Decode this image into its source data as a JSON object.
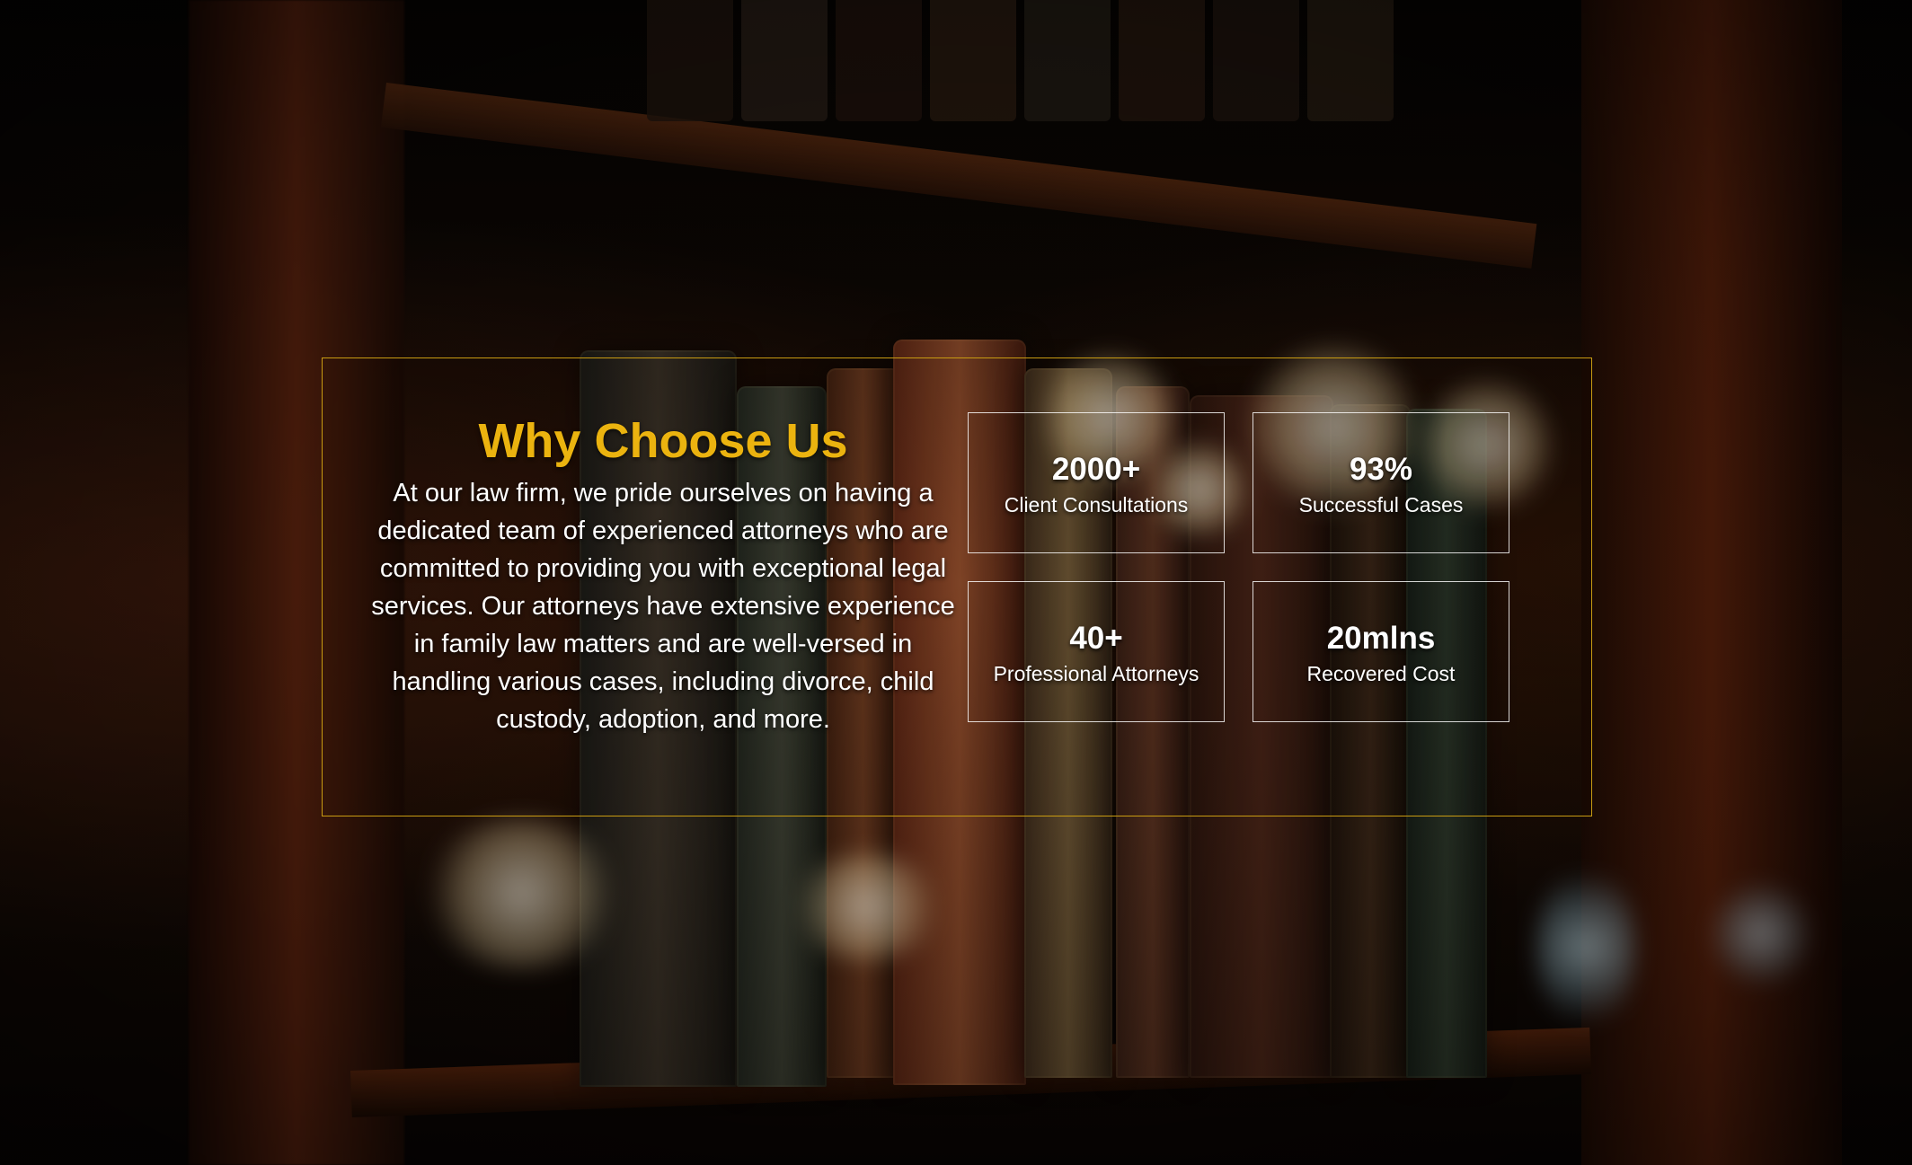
{
  "section": {
    "title": "Why Choose Us",
    "description": "At our law firm, we pride ourselves on having a dedicated team of experienced attorneys who are committed to providing you with exceptional legal services. Our attorneys have extensive experience in family law matters and are well-versed in handling various cases, including divorce, child custody, adoption, and more."
  },
  "stats": [
    {
      "value": "2000+",
      "label": "Client Consultations"
    },
    {
      "value": "93%",
      "label": "Successful Cases"
    },
    {
      "value": "40+",
      "label": "Professional Attorneys"
    },
    {
      "value": "20mlns",
      "label": "Recovered Cost"
    }
  ],
  "colors": {
    "title_gold": "#ebb30f",
    "box_border_gold": "#c89b12",
    "text_white": "#ffffff"
  }
}
